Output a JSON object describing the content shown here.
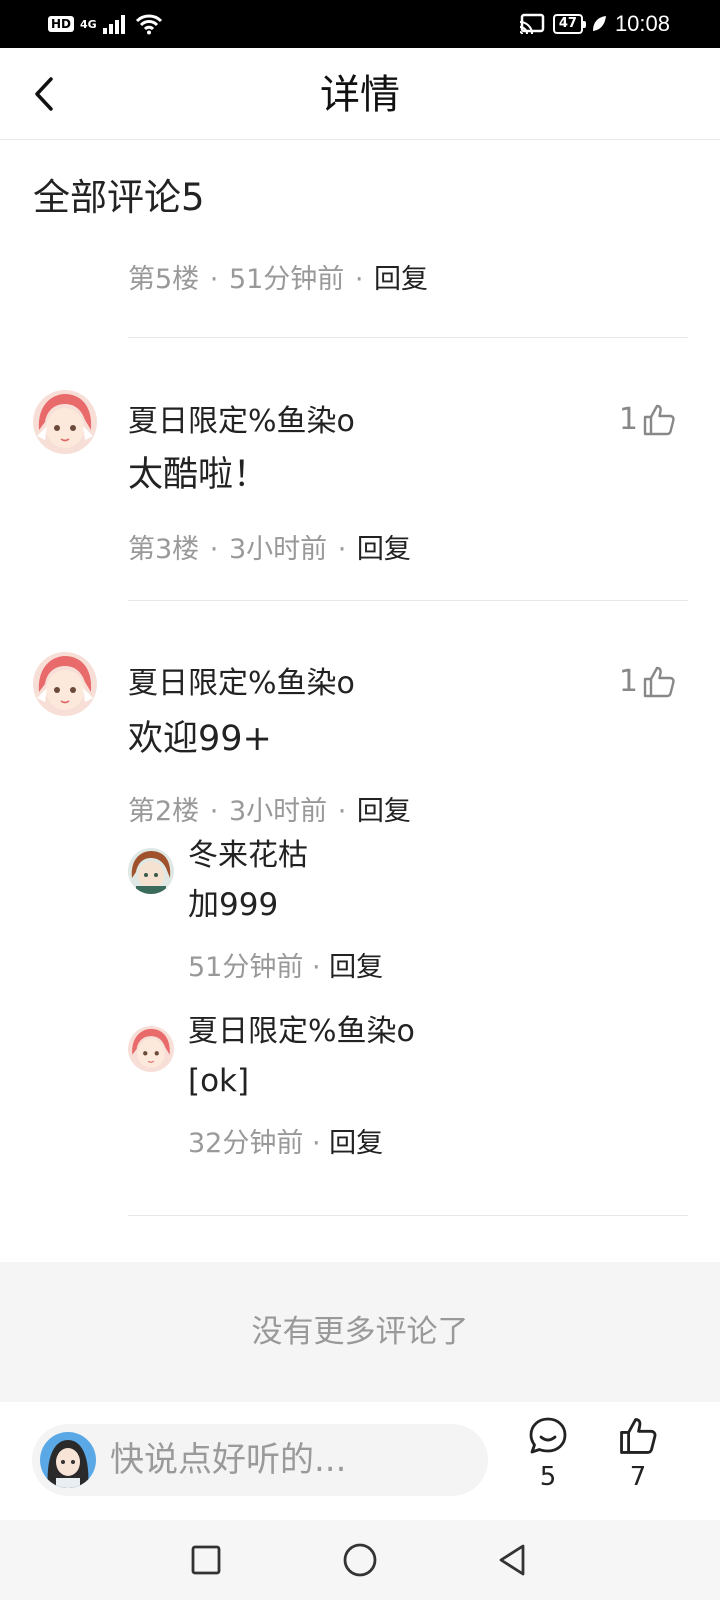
{
  "status_bar": {
    "hd": "HD",
    "network": "4G",
    "battery": "47",
    "time": "10:08"
  },
  "header": {
    "title": "详情"
  },
  "comments_section": {
    "title": "全部评论5"
  },
  "comments": [
    {
      "meta_floor": "第5楼",
      "meta_time": "51分钟前",
      "reply_label": "回复"
    },
    {
      "author": "夏日限定%鱼染o",
      "text": "太酷啦！",
      "likes": "1",
      "meta_floor": "第3楼",
      "meta_time": "3小时前",
      "reply_label": "回复"
    },
    {
      "author": "夏日限定%鱼染o",
      "text": "欢迎99+",
      "likes": "1",
      "meta_floor": "第2楼",
      "meta_time": "3小时前",
      "reply_label": "回复",
      "replies": [
        {
          "author": "冬来花枯",
          "text": "加999",
          "meta_time": "51分钟前",
          "reply_label": "回复"
        },
        {
          "author": "夏日限定%鱼染o",
          "text": "[ok]",
          "meta_time": "32分钟前",
          "reply_label": "回复"
        }
      ]
    }
  ],
  "footer_note": "没有更多评论了",
  "bottom_bar": {
    "input_placeholder": "快说点好听的...",
    "comment_count": "5",
    "like_count": "7"
  },
  "colors": {
    "text_primary": "#222222",
    "text_secondary": "#999999",
    "divider": "#e8e8e8",
    "footer_bg": "#f5f5f5"
  }
}
